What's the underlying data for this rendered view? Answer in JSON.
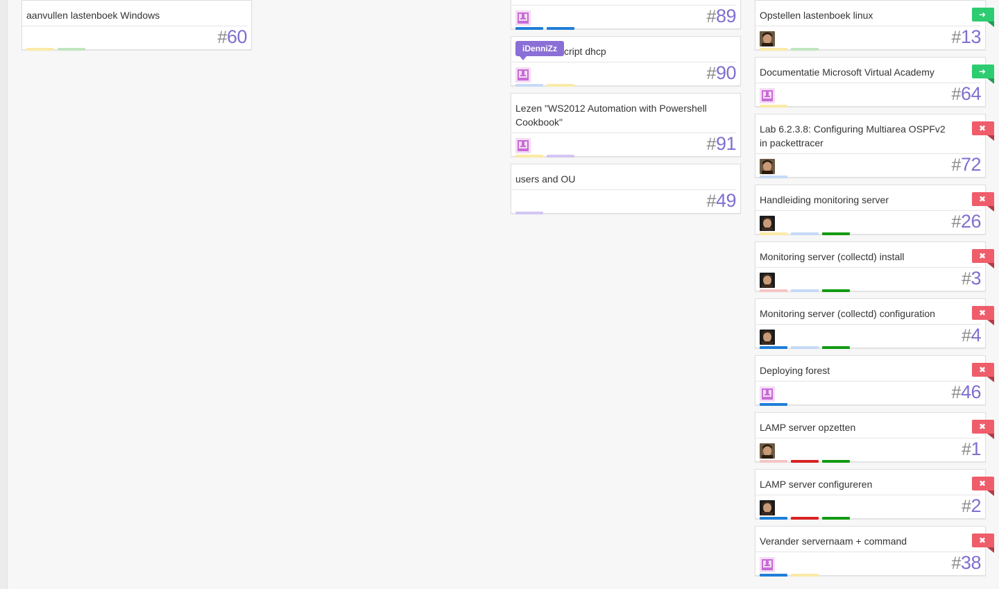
{
  "colors": {
    "issue_number": "#7f6fd1",
    "move_flag": "#2ecc71",
    "close_flag": "#ef5d6b",
    "tooltip": "#8a6fd6",
    "label_yellow": "#fbeaa6",
    "label_green_light": "#bfe6c0",
    "label_blue": "#1f7ed8",
    "label_blue_light": "#c5daf6",
    "label_purple_light": "#d3c6f3",
    "label_green": "#119a11",
    "label_red": "#d82222",
    "label_pink": "#f6c5c5"
  },
  "icons": {
    "move": "arrow-right-icon",
    "close": "close-icon",
    "identicon": "identicon-avatar",
    "photo": "user-photo-avatar"
  },
  "flag_glyphs": {
    "move": "➜",
    "close": "✖"
  },
  "tooltip": {
    "text": "iDenniZz"
  },
  "columns": [
    {
      "id": "col-a",
      "cards": [
        {
          "title": "aanvullen lastenboek Windows",
          "number": "60",
          "avatar": "none",
          "flag": "none",
          "labels": [
            "label_yellow",
            "label_green_light"
          ]
        }
      ]
    },
    {
      "id": "col-b",
      "cards": [
        {
          "title": "",
          "number": "89",
          "avatar": "identicon",
          "flag": "none",
          "labels": [
            "label_blue",
            "label_blue"
          ]
        },
        {
          "title": "script dhcp",
          "number": "90",
          "avatar": "identicon",
          "flag": "none",
          "labels": [
            "label_blue_light",
            "label_yellow"
          ],
          "tooltip": true
        },
        {
          "title": "Lezen \"WS2012 Automation with Powershell Cookbook\"",
          "number": "91",
          "avatar": "identicon",
          "flag": "none",
          "labels": [
            "label_yellow",
            "label_purple_light"
          ]
        },
        {
          "title": "users and OU",
          "number": "49",
          "avatar": "none",
          "flag": "none",
          "labels": [
            "label_purple_light"
          ]
        }
      ]
    },
    {
      "id": "col-c",
      "cards": [
        {
          "title": "Opstellen lastenboek linux",
          "number": "13",
          "avatar": "photo-a",
          "flag": "move",
          "labels": [
            "label_yellow",
            "label_green_light"
          ]
        },
        {
          "title": "Documentatie Microsoft Virtual Academy",
          "number": "64",
          "avatar": "identicon",
          "flag": "move",
          "labels": [
            "label_yellow"
          ]
        },
        {
          "title": "Lab 6.2.3.8: Configuring Multiarea OSPFv2 in packettracer",
          "number": "72",
          "avatar": "photo-a",
          "flag": "close",
          "labels": [
            "label_blue_light"
          ]
        },
        {
          "title": "Handleiding monitoring server",
          "number": "26",
          "avatar": "photo-b",
          "flag": "close",
          "labels": [
            "label_yellow",
            "label_blue_light",
            "label_green"
          ]
        },
        {
          "title": "Monitoring server (collectd) install",
          "number": "3",
          "avatar": "photo-b",
          "flag": "close",
          "labels": [
            "label_pink",
            "label_blue_light",
            "label_green"
          ]
        },
        {
          "title": "Monitoring server (collectd) configuration",
          "number": "4",
          "avatar": "photo-b",
          "flag": "close",
          "labels": [
            "label_blue",
            "label_blue_light",
            "label_green"
          ]
        },
        {
          "title": "Deploying forest",
          "number": "46",
          "avatar": "identicon",
          "flag": "close",
          "labels": [
            "label_blue"
          ]
        },
        {
          "title": "LAMP server opzetten",
          "number": "1",
          "avatar": "photo-a",
          "flag": "close",
          "labels": [
            "label_pink",
            "label_red",
            "label_green"
          ]
        },
        {
          "title": "LAMP server configureren",
          "number": "2",
          "avatar": "photo-b",
          "flag": "close",
          "labels": [
            "label_blue",
            "label_red",
            "label_green"
          ]
        },
        {
          "title": "Verander servernaam + command",
          "number": "38",
          "avatar": "identicon",
          "flag": "close",
          "labels": [
            "label_blue",
            "label_yellow"
          ]
        }
      ]
    }
  ]
}
